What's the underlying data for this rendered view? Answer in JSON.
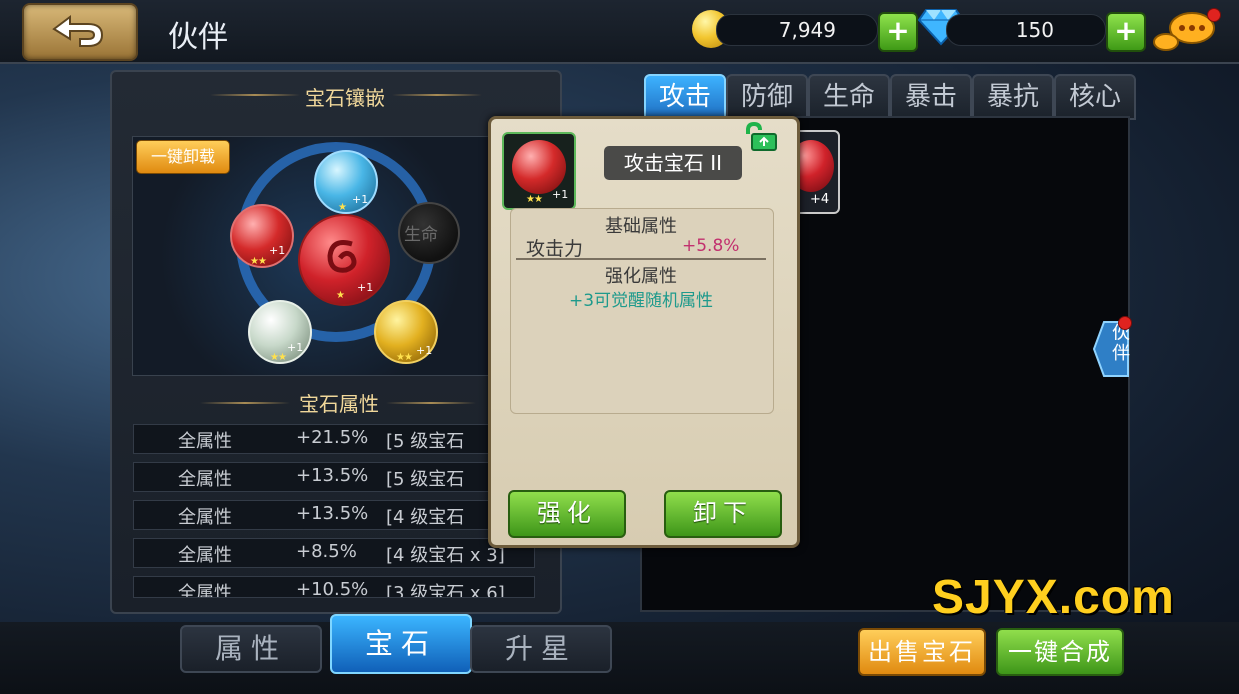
{
  "header": {
    "title": "伙伴",
    "gold": "7,949",
    "diamonds": "150"
  },
  "left_panel": {
    "inlay_title": "宝石镶嵌",
    "unload_all": "一键卸载",
    "center_gem_level": "+1",
    "slots": [
      {
        "color": "blue",
        "stars": "★",
        "level": "+1"
      },
      {
        "color": "red",
        "stars": "★★",
        "level": "+1"
      },
      {
        "color": "empty",
        "label": "生命"
      },
      {
        "color": "white",
        "stars": "★★",
        "level": "+1"
      },
      {
        "color": "gold",
        "stars": "★★",
        "level": "+1"
      }
    ],
    "attr_title": "宝石属性",
    "attributes": [
      {
        "name": "全属性",
        "value": "+21.5%",
        "source": "[5 级宝石"
      },
      {
        "name": "全属性",
        "value": "+13.5%",
        "source": "[5 级宝石"
      },
      {
        "name": "全属性",
        "value": "+13.5%",
        "source": "[4 级宝石"
      },
      {
        "name": "全属性",
        "value": "+8.5%",
        "source": "[4 级宝石 x 3]"
      },
      {
        "name": "全属性",
        "value": "+10.5%",
        "source": "[3 级宝石 x 6]"
      }
    ]
  },
  "bottom_tabs": [
    "属性",
    "宝石",
    "升星"
  ],
  "right_tabs": [
    "攻击",
    "防御",
    "生命",
    "暴击",
    "暴抗",
    "核心"
  ],
  "inventory": {
    "item_level": "+4"
  },
  "side_tab": "伙伴",
  "popup": {
    "gem_name": "攻击宝石 II",
    "icon_level": "+1",
    "icon_stars": "★★",
    "base_title": "基础属性",
    "base_attr_name": "攻击力",
    "base_attr_value": "+5.8%",
    "enhance_title": "强化属性",
    "enhance_text": "+3可觉醒随机属性",
    "enhance_button": "强化",
    "remove_button": "卸下"
  },
  "actions": {
    "sell": "出售宝石",
    "synth": "一键合成"
  },
  "watermark": "SJYX.com",
  "colors": {
    "accent_blue": "#2f8fe0",
    "green_button": "#5bb72a",
    "gold_text": "#f0d79a",
    "attr_value_pink": "#c2306e",
    "enhance_text_teal": "#1e9a8c"
  }
}
